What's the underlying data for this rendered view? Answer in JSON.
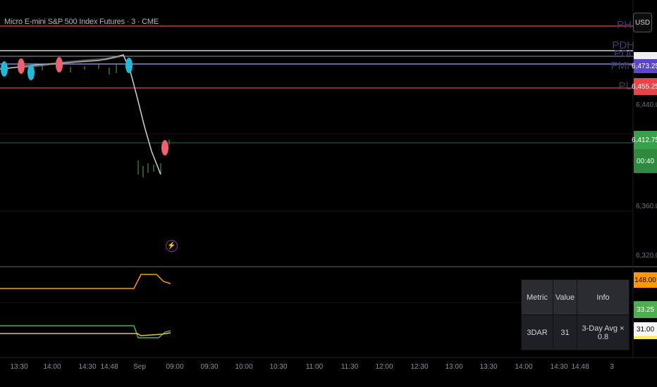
{
  "header": {
    "title": "Micro E-mini S&P 500 Index Futures · 3 · CME"
  },
  "currency_button": {
    "label": "USD"
  },
  "level_labels": {
    "ph": "PH",
    "pdh": "PDH",
    "pdl": "PDL",
    "pl": "PL",
    "pmh": "PMH"
  },
  "price_axis": {
    "ticks": [
      "6,440.00",
      "6,360.00",
      "6,320.00"
    ],
    "tags": {
      "level_high": {
        "value": "6,473.25",
        "color": "#5b45c8"
      },
      "level_low": {
        "value": "6,455.25",
        "color": "#e8454a"
      },
      "last_price": {
        "value": "6,412.75",
        "countdown": "00:40",
        "color": "#38a04a"
      }
    }
  },
  "indicator_axis": {
    "tags": {
      "orange": {
        "value": "148.00",
        "color": "#ff9800"
      },
      "green": {
        "value": "33.25",
        "color": "#4caf50"
      },
      "yellow": {
        "value": "31.00",
        "color": "#ffeb3b"
      }
    }
  },
  "metrics_table": {
    "headers": {
      "metric": "Metric",
      "value": "Value",
      "info": "Info"
    },
    "rows": [
      {
        "metric": "3DAR",
        "value": "31",
        "info": "3-Day Avg × 0.8"
      }
    ]
  },
  "time_axis": {
    "labels": [
      "13:30",
      "14:00",
      "14:30",
      "14:48",
      "Sep",
      "09:00",
      "09:30",
      "10:00",
      "10:30",
      "11:00",
      "11:30",
      "12:00",
      "12:30",
      "13:00",
      "13:30",
      "14:00",
      "14:30",
      "14:48",
      "3"
    ]
  },
  "colors": {
    "background": "#000000",
    "resistance": "#c2363e",
    "support_purple": "#8a84d8",
    "last_price_line": "#1f6b2a",
    "price_path": "#cfcfcf",
    "red_marker": "#f06070",
    "cyan_marker": "#22b8d8"
  }
}
